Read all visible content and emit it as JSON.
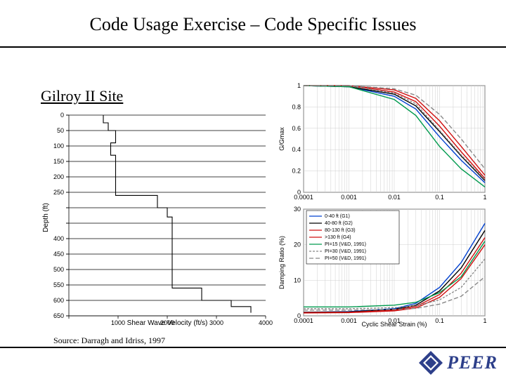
{
  "title": "Code Usage Exercise – Code Specific Issues",
  "subtitle": "Gilroy II Site",
  "source_line": "Source: Darragh and Idriss, 1997",
  "logo": {
    "text": "PEER"
  },
  "chart_data": [
    {
      "id": "vs-profile",
      "type": "line",
      "orientation": "step (depth-vs-Vs profile)",
      "xlabel": "Shear Wave Velocity (ft/s)",
      "ylabel": "Depth (ft)",
      "xlim": [
        0,
        4000
      ],
      "ylim_top_to_bottom": [
        0,
        650
      ],
      "x_ticks": [
        0,
        1000,
        2000,
        3000,
        4000
      ],
      "x_tick_labels": [
        "",
        "1000",
        "2000",
        "3000",
        "4000"
      ],
      "y_ticks": [
        0,
        50,
        100,
        150,
        200,
        250,
        300,
        350,
        400,
        450,
        500,
        550,
        600,
        650
      ],
      "y_tick_labels": [
        "0",
        "50",
        "100",
        "150",
        "200",
        "250",
        "",
        "",
        "400",
        "450",
        "500",
        "550",
        "600",
        "650"
      ],
      "layers_depth_vs": [
        {
          "from_depth": 0,
          "to_depth": 25,
          "vs": 700
        },
        {
          "from_depth": 25,
          "to_depth": 50,
          "vs": 800
        },
        {
          "from_depth": 50,
          "to_depth": 90,
          "vs": 950
        },
        {
          "from_depth": 90,
          "to_depth": 130,
          "vs": 850
        },
        {
          "from_depth": 130,
          "to_depth": 260,
          "vs": 950
        },
        {
          "from_depth": 260,
          "to_depth": 300,
          "vs": 1800
        },
        {
          "from_depth": 300,
          "to_depth": 330,
          "vs": 2000
        },
        {
          "from_depth": 330,
          "to_depth": 560,
          "vs": 2100
        },
        {
          "from_depth": 560,
          "to_depth": 600,
          "vs": 2700
        },
        {
          "from_depth": 600,
          "to_depth": 620,
          "vs": 3300
        },
        {
          "from_depth": 620,
          "to_depth": 640,
          "vs": 3700
        }
      ]
    },
    {
      "id": "g-gmax",
      "type": "line",
      "xlabel": "",
      "ylabel": "G/Gmax",
      "x_scale": "log",
      "xlim": [
        0.0001,
        1
      ],
      "ylim": [
        0,
        1
      ],
      "x_ticks": [
        0.0001,
        0.001,
        0.01,
        0.1,
        1
      ],
      "x_tick_labels": [
        "0.0001",
        "0.001",
        "0.01",
        "0.1",
        "1"
      ],
      "y_ticks": [
        0,
        0.2,
        0.4,
        0.6,
        0.8,
        1
      ],
      "series": [
        {
          "name": "0-40 ft (G1)",
          "color": "#0040d0",
          "x": [
            0.0001,
            0.001,
            0.01,
            0.03,
            0.1,
            0.3,
            1
          ],
          "y": [
            1.0,
            0.99,
            0.9,
            0.78,
            0.52,
            0.3,
            0.09
          ]
        },
        {
          "name": "40-80 ft (G2)",
          "color": "#000000",
          "x": [
            0.0001,
            0.001,
            0.01,
            0.03,
            0.1,
            0.3,
            1
          ],
          "y": [
            1.0,
            0.99,
            0.92,
            0.81,
            0.57,
            0.34,
            0.11
          ]
        },
        {
          "name": "80-130 ft (G3)",
          "color": "#d01010",
          "x": [
            0.0001,
            0.001,
            0.01,
            0.03,
            0.1,
            0.3,
            1
          ],
          "y": [
            1.0,
            1.0,
            0.94,
            0.85,
            0.62,
            0.38,
            0.13
          ]
        },
        {
          "name": ">130 ft (G4)",
          "color": "#d01010",
          "x": [
            0.0001,
            0.001,
            0.01,
            0.03,
            0.1,
            0.3,
            1
          ],
          "y": [
            1.0,
            1.0,
            0.96,
            0.88,
            0.67,
            0.43,
            0.16
          ]
        },
        {
          "name": "PI=15 (V&D, 1991)",
          "color": "#009a4e",
          "x": [
            0.0001,
            0.001,
            0.01,
            0.03,
            0.1,
            0.3,
            1
          ],
          "y": [
            1.0,
            0.99,
            0.87,
            0.72,
            0.43,
            0.22,
            0.05
          ]
        },
        {
          "name": "PI=30 (V&D, 1991)",
          "color": "#888888",
          "dash": "3,2",
          "x": [
            0.0001,
            0.001,
            0.01,
            0.03,
            0.1,
            0.3,
            1
          ],
          "y": [
            1.0,
            1.0,
            0.93,
            0.83,
            0.58,
            0.35,
            0.12
          ]
        },
        {
          "name": "PI=50 (V&D, 1991)",
          "color": "#888888",
          "dash": "6,3",
          "x": [
            0.0001,
            0.001,
            0.01,
            0.03,
            0.1,
            0.3,
            1
          ],
          "y": [
            1.0,
            1.0,
            0.97,
            0.91,
            0.73,
            0.5,
            0.22
          ]
        }
      ]
    },
    {
      "id": "damping",
      "type": "line",
      "xlabel": "Cyclic Shear Strain (%)",
      "ylabel": "Damping Ratio (%)",
      "x_scale": "log",
      "xlim": [
        0.0001,
        1
      ],
      "ylim": [
        0,
        30
      ],
      "x_ticks": [
        0.0001,
        0.001,
        0.01,
        0.1,
        1
      ],
      "x_tick_labels": [
        "0.0001",
        "0.001",
        "0.01",
        "0.1",
        "1"
      ],
      "y_ticks": [
        0,
        10,
        20,
        30
      ],
      "legend": [
        {
          "name": "0-40 ft (G1)",
          "color": "#0040d0"
        },
        {
          "name": "40-80 ft (G2)",
          "color": "#000000"
        },
        {
          "name": "80-130 ft (G3)",
          "color": "#d01010"
        },
        {
          "name": ">130 ft (G4)",
          "color": "#d01010"
        },
        {
          "name": "PI=15 (V&D, 1991)",
          "color": "#009a4e"
        },
        {
          "name": "PI=30 (V&D, 1991)",
          "color": "#888888",
          "dash": "3,2"
        },
        {
          "name": "PI=50 (V&D, 1991)",
          "color": "#888888",
          "dash": "6,3"
        }
      ],
      "series": [
        {
          "name": "0-40 ft (G1)",
          "color": "#0040d0",
          "x": [
            0.0001,
            0.001,
            0.01,
            0.03,
            0.1,
            0.3,
            1
          ],
          "y": [
            1.0,
            1.2,
            2.0,
            3.5,
            8.0,
            15.0,
            26.0
          ]
        },
        {
          "name": "40-80 ft (G2)",
          "color": "#000000",
          "x": [
            0.0001,
            0.001,
            0.01,
            0.03,
            0.1,
            0.3,
            1
          ],
          "y": [
            1.0,
            1.1,
            1.8,
            3.0,
            7.0,
            13.5,
            24.0
          ]
        },
        {
          "name": "80-130 ft (G3)",
          "color": "#d01010",
          "x": [
            0.0001,
            0.001,
            0.01,
            0.03,
            0.1,
            0.3,
            1
          ],
          "y": [
            0.9,
            1.0,
            1.6,
            2.6,
            6.0,
            12.0,
            22.0
          ]
        },
        {
          "name": ">130 ft (G4)",
          "color": "#d01010",
          "x": [
            0.0001,
            0.001,
            0.01,
            0.03,
            0.1,
            0.3,
            1
          ],
          "y": [
            0.8,
            0.9,
            1.4,
            2.2,
            5.2,
            10.5,
            20.0
          ]
        },
        {
          "name": "PI=15 (V&D, 1991)",
          "color": "#009a4e",
          "x": [
            0.0001,
            0.001,
            0.01,
            0.03,
            0.1,
            0.3,
            1
          ],
          "y": [
            2.5,
            2.5,
            3.0,
            3.8,
            6.5,
            11.0,
            21.0
          ]
        },
        {
          "name": "PI=30 (V&D, 1991)",
          "color": "#888888",
          "dash": "3,2",
          "x": [
            0.0001,
            0.001,
            0.01,
            0.03,
            0.1,
            0.3,
            1
          ],
          "y": [
            2.0,
            2.0,
            2.3,
            2.8,
            4.5,
            8.0,
            16.0
          ]
        },
        {
          "name": "PI=50 (V&D, 1991)",
          "color": "#888888",
          "dash": "6,3",
          "x": [
            0.0001,
            0.001,
            0.01,
            0.03,
            0.1,
            0.3,
            1
          ],
          "y": [
            1.6,
            1.6,
            1.8,
            2.1,
            3.3,
            5.5,
            11.0
          ]
        }
      ]
    }
  ]
}
